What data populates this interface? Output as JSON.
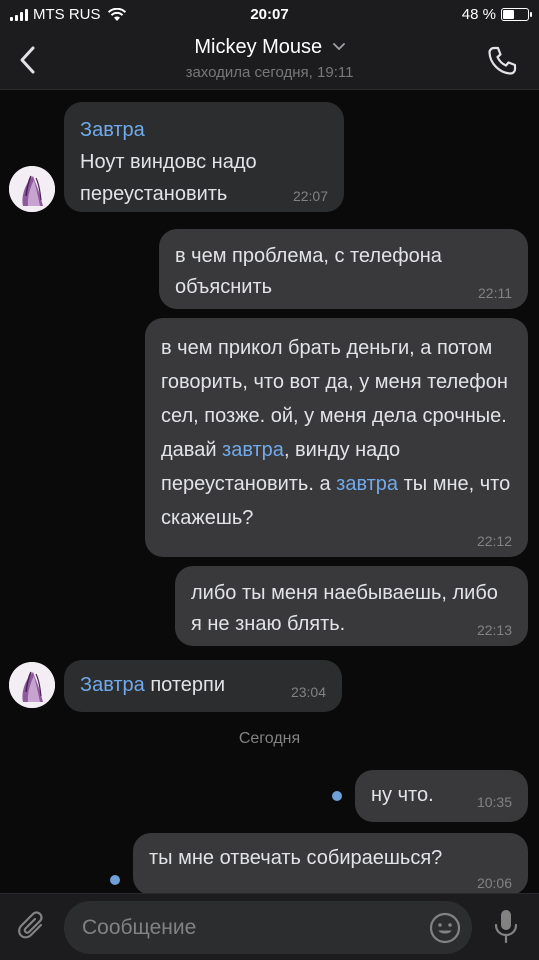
{
  "status_bar": {
    "carrier": "MTS RUS",
    "time": "20:07",
    "battery": "48 %",
    "battery_level": 0.48,
    "signal_bars": 4
  },
  "header": {
    "contact_name": "Mickey Mouse",
    "last_seen": "заходила сегодня, 19:11"
  },
  "messages": [
    {
      "direction": "in",
      "time": "22:07",
      "parts": [
        {
          "text": "Завтра",
          "link": true
        },
        {
          "text": "\nНоут виндовс надо переустановить"
        }
      ]
    },
    {
      "direction": "out",
      "time": "22:11",
      "parts": [
        {
          "text": "в чем проблема, с телефона объяснить"
        }
      ]
    },
    {
      "direction": "out",
      "time": "22:12",
      "parts": [
        {
          "text": "в чем прикол брать деньги, а потом говорить, что вот да, у меня телефон сел, позже. ой, у меня дела срочные. давай "
        },
        {
          "text": "завтра",
          "link": true
        },
        {
          "text": ", винду надо переустановить. а "
        },
        {
          "text": "завтра",
          "link": true
        },
        {
          "text": " ты мне, что скажешь?"
        }
      ]
    },
    {
      "direction": "out",
      "time": "22:13",
      "parts": [
        {
          "text": "либо ты меня наебываешь, либо я не знаю блять."
        }
      ]
    },
    {
      "direction": "in",
      "time": "23:04",
      "parts": [
        {
          "text": "Завтра",
          "link": true
        },
        {
          "text": " потерпи"
        }
      ]
    },
    {
      "direction": "out",
      "time": "10:35",
      "unread": true,
      "parts": [
        {
          "text": "ну что."
        }
      ]
    },
    {
      "direction": "out",
      "time": "20:06",
      "unread": true,
      "parts": [
        {
          "text": "ты мне отвечать собираешься?"
        }
      ]
    }
  ],
  "date_separator": "Сегодня",
  "composer": {
    "placeholder": "Сообщение"
  },
  "colors": {
    "background": "#0a0a0a",
    "bar": "#1c1c1e",
    "bubble_in": "#2c2d2e",
    "bubble_out": "#39393b",
    "link": "#71aaeb",
    "unread_dot": "#6fa0d8"
  }
}
